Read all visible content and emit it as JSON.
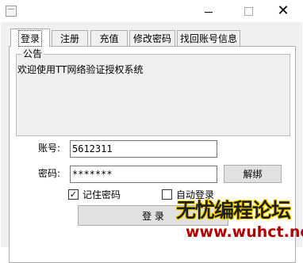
{
  "window": {
    "title": "",
    "minimize_label": "—",
    "maximize_label": "☐",
    "close_label": "✕"
  },
  "tabs": [
    {
      "label": "登录",
      "active": true
    },
    {
      "label": "注册"
    },
    {
      "label": "充值"
    },
    {
      "label": "修改密码"
    },
    {
      "label": "找回账号信息"
    }
  ],
  "notice": {
    "title": "公告",
    "text": "欢迎使用TT网络验证授权系统"
  },
  "login": {
    "account_label": "账号:",
    "account_value": "5612311",
    "password_label": "密码:",
    "password_value": "*******",
    "unbind_button": "解绑",
    "remember_label": "记住密码",
    "remember_checked": "✓",
    "auto_login_label": "自动登录",
    "login_button": "登 录"
  },
  "watermark": {
    "line1": "无忧编程论坛",
    "line2": "www.wuhct.net"
  }
}
